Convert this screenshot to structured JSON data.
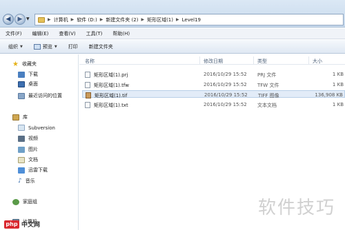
{
  "address_bar": {
    "crumbs": [
      "计算机",
      "软件 (D:)",
      "新建文件夹 (2)",
      "矩形区域(1)",
      "Level19"
    ]
  },
  "menu": [
    "文件(F)",
    "编辑(E)",
    "查看(V)",
    "工具(T)",
    "帮助(H)"
  ],
  "toolbar": {
    "organize": "组织",
    "preview": "预览",
    "print": "打印",
    "new_folder": "新建文件夹"
  },
  "sidebar": {
    "favorites": "收藏夹",
    "downloads": "下载",
    "desktop": "桌面",
    "recent": "最近访问的位置",
    "libraries": "库",
    "subversion": "Subversion",
    "videos": "视频",
    "pictures": "图片",
    "documents": "文档",
    "thunder": "迅雷下载",
    "music": "音乐",
    "homegroup": "家庭组",
    "computer": "计算机"
  },
  "columns": {
    "name": "名称",
    "date": "修改日期",
    "type": "类型",
    "size": "大小"
  },
  "files": [
    {
      "name": "矩形区域(1).prj",
      "date": "2016/10/29 15:52",
      "type": "PRJ 文件",
      "size": "1 KB"
    },
    {
      "name": "矩形区域(1).tfw",
      "date": "2016/10/29 15:52",
      "type": "TFW 文件",
      "size": "1 KB"
    },
    {
      "name": "矩形区域(1).tif",
      "date": "2016/10/29 15:52",
      "type": "TIFF 图像",
      "size": "136,908 KB"
    },
    {
      "name": "矩形区域(1).txt",
      "date": "2016/10/29 15:52",
      "type": "文本文档",
      "size": "1 KB"
    }
  ],
  "watermark": "软件技巧",
  "site_logo": "php",
  "site_name": "中文网"
}
